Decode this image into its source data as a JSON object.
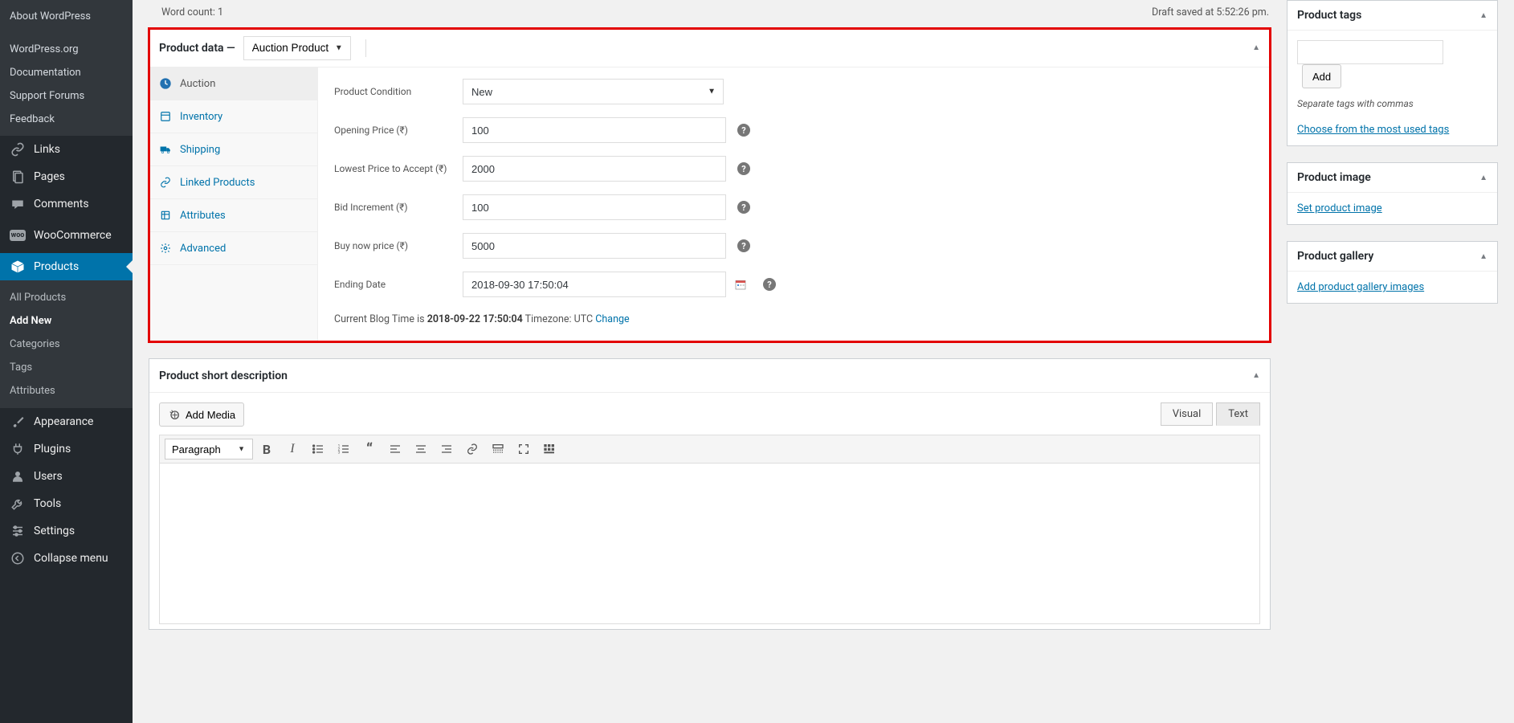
{
  "sidebar": {
    "about": "About WordPress",
    "external": [
      "WordPress.org",
      "Documentation",
      "Support Forums",
      "Feedback"
    ],
    "main": [
      {
        "icon": "link",
        "label": "Links"
      },
      {
        "icon": "pages",
        "label": "Pages"
      },
      {
        "icon": "comments",
        "label": "Comments"
      },
      {
        "icon": "woo",
        "label": "WooCommerce"
      }
    ],
    "products": {
      "label": "Products",
      "icon": "box"
    },
    "products_sub": [
      "All Products",
      "Add New",
      "Categories",
      "Tags",
      "Attributes"
    ],
    "bottom": [
      {
        "icon": "brush",
        "label": "Appearance"
      },
      {
        "icon": "plug",
        "label": "Plugins"
      },
      {
        "icon": "users",
        "label": "Users"
      },
      {
        "icon": "wrench",
        "label": "Tools"
      },
      {
        "icon": "settings",
        "label": "Settings"
      },
      {
        "icon": "collapse",
        "label": "Collapse menu"
      }
    ]
  },
  "top": {
    "word_count_label": "Word count:",
    "word_count_value": "1",
    "draft_saved": "Draft saved at 5:52:26 pm."
  },
  "product_data": {
    "title": "Product data",
    "dash": "—",
    "type_selected": "Auction Product",
    "tabs": [
      {
        "icon": "auction",
        "label": "Auction"
      },
      {
        "icon": "inventory",
        "label": "Inventory"
      },
      {
        "icon": "shipping",
        "label": "Shipping"
      },
      {
        "icon": "linked",
        "label": "Linked Products"
      },
      {
        "icon": "attributes",
        "label": "Attributes"
      },
      {
        "icon": "advanced",
        "label": "Advanced"
      }
    ],
    "fields": {
      "condition": {
        "label": "Product Condition",
        "value": "New"
      },
      "opening": {
        "label": "Opening Price (₹)",
        "value": "100"
      },
      "lowest": {
        "label": "Lowest Price to Accept (₹)",
        "value": "2000"
      },
      "increment": {
        "label": "Bid Increment (₹)",
        "value": "100"
      },
      "buynow": {
        "label": "Buy now price (₹)",
        "value": "5000"
      },
      "ending": {
        "label": "Ending Date",
        "value": "2018-09-30 17:50:04"
      }
    },
    "blog_time": {
      "prefix": "Current Blog Time is ",
      "time": "2018-09-22 17:50:04",
      "tz": " Timezone: UTC",
      "change": " Change"
    }
  },
  "short_desc": {
    "title": "Product short description",
    "add_media": "Add Media",
    "visual": "Visual",
    "text": "Text",
    "paragraph": "Paragraph"
  },
  "right": {
    "tags": {
      "title": "Product tags",
      "add": "Add",
      "hint": "Separate tags with commas",
      "choose": "Choose from the most used tags"
    },
    "image": {
      "title": "Product image",
      "set": "Set product image"
    },
    "gallery": {
      "title": "Product gallery",
      "add": "Add product gallery images"
    }
  }
}
